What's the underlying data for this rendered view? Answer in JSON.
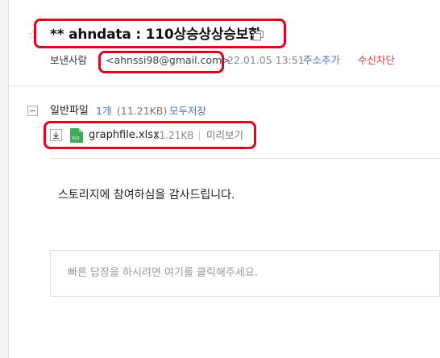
{
  "mail": {
    "subject": "** ahndata : 110상승상상승보합",
    "sender_label": "보낸사람",
    "sender_email": "<ahnssi98@gmail.com>",
    "date": "22.01.05 13:51",
    "add_contact": "주소추가",
    "block_sender": "수신차단"
  },
  "attachments": {
    "label": "일반파일",
    "count": "1개",
    "total_size": "(11.21KB)",
    "save_all": "모두저장",
    "files": [
      {
        "name": "graphfile.xlsx",
        "size": "11.21KB",
        "preview": "미리보기",
        "icon": "xlsx-file-icon",
        "icon_label": "XLS"
      }
    ]
  },
  "body": {
    "text": "스토리지에 참여하심을 감사드립니다."
  },
  "reply": {
    "placeholder": "빠른 답장을 하시려면 여기를 클릭해주세요."
  },
  "colors": {
    "link": "#4a74c9",
    "block": "#e23b3b",
    "annotation": "#e5001c",
    "xlsx_icon": "#3eaa5a"
  }
}
